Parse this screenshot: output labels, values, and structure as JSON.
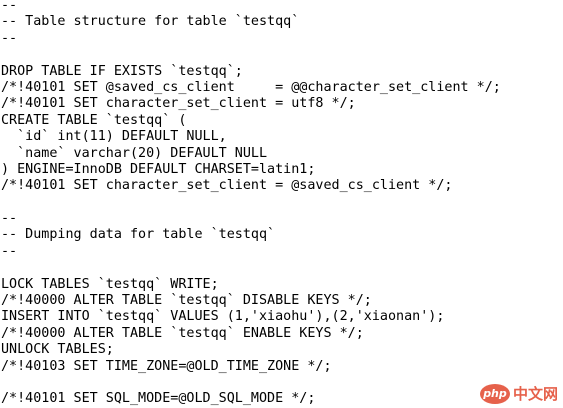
{
  "lines": [
    "--",
    "-- Table structure for table `testqq`",
    "--",
    "",
    "DROP TABLE IF EXISTS `testqq`;",
    "/*!40101 SET @saved_cs_client     = @@character_set_client */;",
    "/*!40101 SET character_set_client = utf8 */;",
    "CREATE TABLE `testqq` (",
    "  `id` int(11) DEFAULT NULL,",
    "  `name` varchar(20) DEFAULT NULL",
    ") ENGINE=InnoDB DEFAULT CHARSET=latin1;",
    "/*!40101 SET character_set_client = @saved_cs_client */;",
    "",
    "--",
    "-- Dumping data for table `testqq`",
    "--",
    "",
    "LOCK TABLES `testqq` WRITE;",
    "/*!40000 ALTER TABLE `testqq` DISABLE KEYS */;",
    "INSERT INTO `testqq` VALUES (1,'xiaohu'),(2,'xiaonan');",
    "/*!40000 ALTER TABLE `testqq` ENABLE KEYS */;",
    "UNLOCK TABLES;",
    "/*!40103 SET TIME_ZONE=@OLD_TIME_ZONE */;",
    "",
    "/*!40101 SET SQL_MODE=@OLD_SQL_MODE */;"
  ],
  "watermark": {
    "logo_text": "php",
    "site_text": "中文网",
    "brand_color": "#e2462c"
  }
}
